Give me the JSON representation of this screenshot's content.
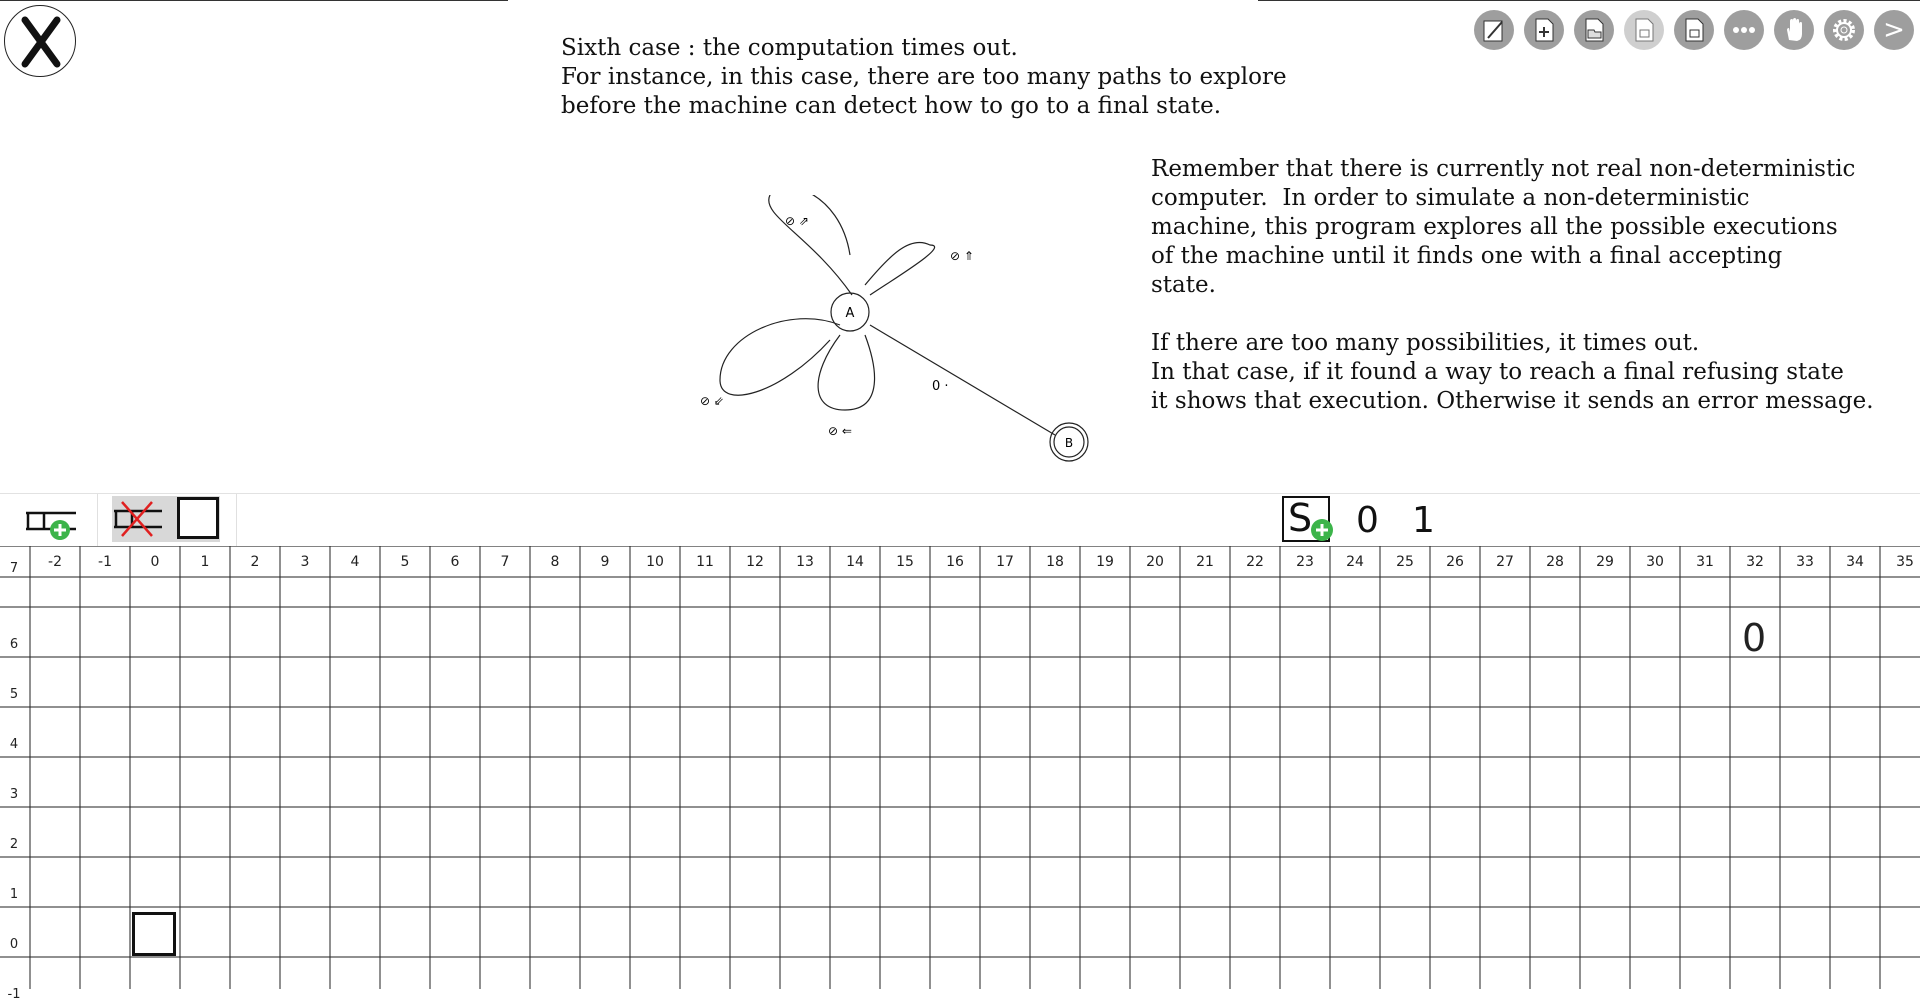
{
  "toolbar": {
    "buttons": [
      {
        "icon": "edit-icon"
      },
      {
        "icon": "new-file-icon"
      },
      {
        "icon": "open-folder-icon"
      },
      {
        "icon": "save-disabled-icon"
      },
      {
        "icon": "save-as-icon"
      },
      {
        "icon": "more-icon"
      },
      {
        "icon": "hand-icon"
      },
      {
        "icon": "settings-icon"
      },
      {
        "icon": "next-icon"
      }
    ],
    "next_label": ">"
  },
  "intro": {
    "line1": "Sixth case : the computation times out.",
    "line2": "For instance, in this case, there are too many paths to explore",
    "line3": "before the machine can detect how to go to a final state."
  },
  "explanation": {
    "p1": "Remember that there is currently not real non-deterministic\ncomputer.  In order to simulate a non-deterministic\nmachine, this program explores all the possible executions\nof the machine until it finds one with a final accepting\nstate.",
    "p2": "If there are too many possibilities, it times out.\nIn that case, if it found a way to reach a final refusing state\nit shows that execution. Otherwise it sends an error message."
  },
  "automaton": {
    "states": [
      "A",
      "B"
    ],
    "loop_labels": [
      "⊘ ⇗",
      "⊘ ⇑",
      "⊘ ⇙",
      "⊘ ⇐"
    ],
    "edge_label": "0 ·"
  },
  "symbols": {
    "start_symbol": "S",
    "alphabet": [
      "0",
      "1"
    ]
  },
  "grid": {
    "columns": [
      "-2",
      "-1",
      "0",
      "1",
      "2",
      "3",
      "4",
      "5",
      "6",
      "7",
      "8",
      "9",
      "10",
      "11",
      "12",
      "13",
      "14",
      "15",
      "16",
      "17",
      "18",
      "19",
      "20",
      "21",
      "22",
      "23",
      "24",
      "25",
      "26",
      "27",
      "28",
      "29",
      "30",
      "31",
      "32",
      "33",
      "34",
      "35"
    ],
    "rows": [
      "7",
      "6",
      "5",
      "4",
      "3",
      "2",
      "1",
      "0",
      "-1"
    ],
    "cells": [
      {
        "col": "32",
        "row": "6",
        "value": "0"
      }
    ],
    "head": {
      "col": "0",
      "row": "0"
    }
  }
}
